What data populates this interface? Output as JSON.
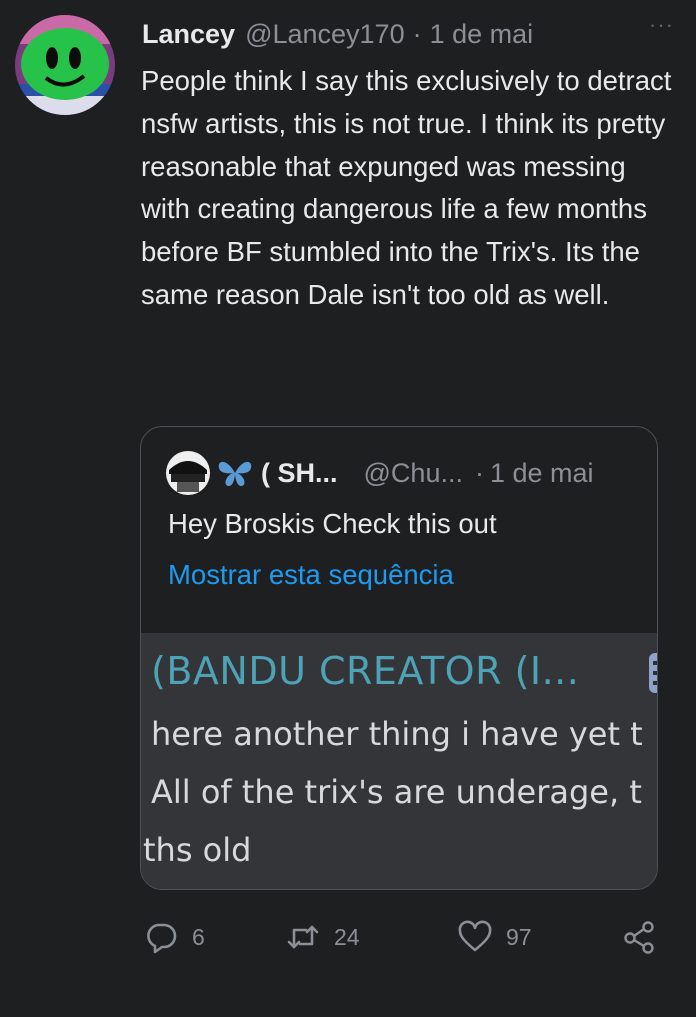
{
  "tweet": {
    "author_name": "Lancey",
    "author_handle": "@Lancey170",
    "separator": "·",
    "time": "1 de mai",
    "more": "···",
    "text": "People think I say this exclusively to detract nsfw artists, this is not true. I think its pretty reasonable that expunged was messing with creating dangerous life a few months before BF stumbled into the Trix's. Its the same reason Dale isn't too old as well."
  },
  "quote": {
    "author_name": "( SH...",
    "author_handle": "@Chu...",
    "separator": "·",
    "time": "1 de mai",
    "text": "Hey Broskis Check this out",
    "show_thread": "Mostrar esta sequência",
    "media": {
      "title": "(BANDU CREATOR (I...",
      "line1": "here another thing i have yet t",
      "line2": "All of the trix's are underage, t",
      "line3": "ths old"
    }
  },
  "actions": {
    "replies": "6",
    "retweets": "24",
    "likes": "97"
  },
  "colors": {
    "background": "#1e1f21",
    "link": "#1d9bf0",
    "muted": "#8b9096",
    "media_title": "#4ea2b5"
  },
  "icons": [
    "avatar",
    "reply-icon",
    "retweet-icon",
    "like-icon",
    "share-icon",
    "butterfly-icon",
    "more-icon"
  ]
}
